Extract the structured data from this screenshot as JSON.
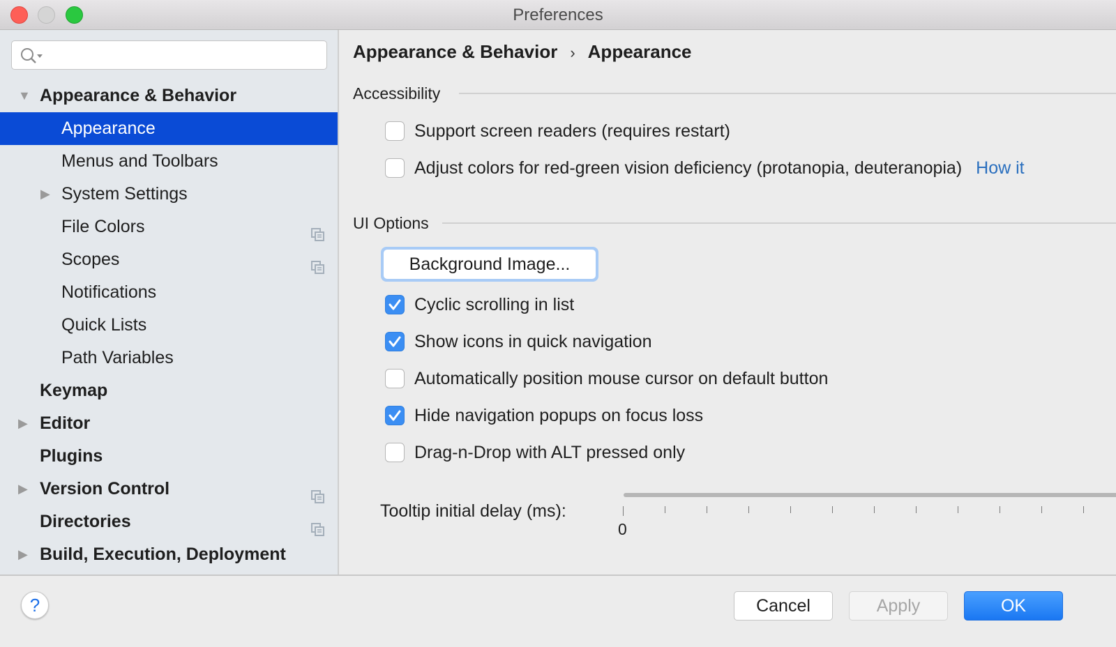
{
  "window": {
    "title": "Preferences"
  },
  "sidebar": {
    "search": {
      "value": "",
      "placeholder": ""
    },
    "items": [
      {
        "label": "Appearance & Behavior",
        "level": 0,
        "bold": true,
        "expander": "expanded",
        "selected": false,
        "has_copy_icon": false
      },
      {
        "label": "Appearance",
        "level": 1,
        "bold": false,
        "expander": "none",
        "selected": true,
        "has_copy_icon": false
      },
      {
        "label": "Menus and Toolbars",
        "level": 1,
        "bold": false,
        "expander": "none",
        "selected": false,
        "has_copy_icon": false
      },
      {
        "label": "System Settings",
        "level": 1,
        "bold": false,
        "expander": "collapsed",
        "selected": false,
        "has_copy_icon": false
      },
      {
        "label": "File Colors",
        "level": 1,
        "bold": false,
        "expander": "none",
        "selected": false,
        "has_copy_icon": true
      },
      {
        "label": "Scopes",
        "level": 1,
        "bold": false,
        "expander": "none",
        "selected": false,
        "has_copy_icon": true
      },
      {
        "label": "Notifications",
        "level": 1,
        "bold": false,
        "expander": "none",
        "selected": false,
        "has_copy_icon": false
      },
      {
        "label": "Quick Lists",
        "level": 1,
        "bold": false,
        "expander": "none",
        "selected": false,
        "has_copy_icon": false
      },
      {
        "label": "Path Variables",
        "level": 1,
        "bold": false,
        "expander": "none",
        "selected": false,
        "has_copy_icon": false
      },
      {
        "label": "Keymap",
        "level": 0,
        "bold": true,
        "expander": "none",
        "selected": false,
        "has_copy_icon": false
      },
      {
        "label": "Editor",
        "level": 0,
        "bold": true,
        "expander": "collapsed",
        "selected": false,
        "has_copy_icon": false
      },
      {
        "label": "Plugins",
        "level": 0,
        "bold": true,
        "expander": "none",
        "selected": false,
        "has_copy_icon": false
      },
      {
        "label": "Version Control",
        "level": 0,
        "bold": true,
        "expander": "collapsed",
        "selected": false,
        "has_copy_icon": true
      },
      {
        "label": "Directories",
        "level": 0,
        "bold": true,
        "expander": "none",
        "selected": false,
        "has_copy_icon": true
      },
      {
        "label": "Build, Execution, Deployment",
        "level": 0,
        "bold": true,
        "expander": "collapsed",
        "selected": false,
        "has_copy_icon": false
      }
    ]
  },
  "breadcrumb": {
    "parent": "Appearance & Behavior",
    "separator": "›",
    "current": "Appearance"
  },
  "accessibility": {
    "title": "Accessibility",
    "options": [
      {
        "label": "Support screen readers (requires restart)",
        "checked": false
      },
      {
        "label": "Adjust colors for red-green vision deficiency (protanopia, deuteranopia)",
        "checked": false,
        "link": "How it"
      }
    ]
  },
  "ui_options": {
    "title": "UI Options",
    "background_image_button": "Background Image...",
    "options": [
      {
        "label": "Cyclic scrolling in list",
        "checked": true
      },
      {
        "label": "Show icons in quick navigation",
        "checked": true
      },
      {
        "label": "Automatically position mouse cursor on default button",
        "checked": false
      },
      {
        "label": "Hide navigation popups on focus loss",
        "checked": true
      },
      {
        "label": "Drag-n-Drop with ALT pressed only",
        "checked": false
      }
    ],
    "tooltip_delay": {
      "label": "Tooltip initial delay (ms):",
      "min_label": "0"
    }
  },
  "footer": {
    "help": "?",
    "cancel": "Cancel",
    "apply": "Apply",
    "apply_enabled": false,
    "ok": "OK"
  },
  "colors": {
    "selection": "#0a4bd6",
    "checkbox_checked": "#3b8ef3",
    "link": "#2a6fbe",
    "primary_button": "#1a77f2"
  }
}
